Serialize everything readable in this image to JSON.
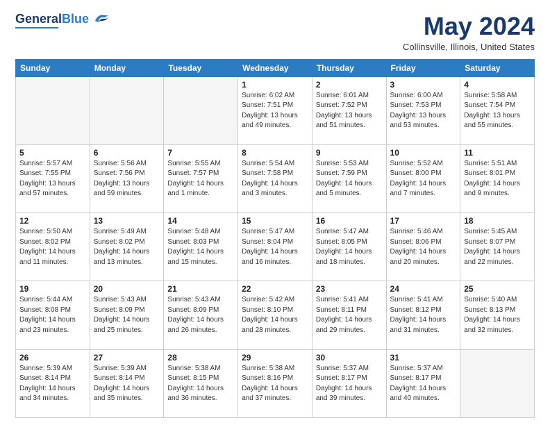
{
  "header": {
    "logo_general": "General",
    "logo_blue": "Blue",
    "month": "May 2024",
    "location": "Collinsville, Illinois, United States"
  },
  "weekdays": [
    "Sunday",
    "Monday",
    "Tuesday",
    "Wednesday",
    "Thursday",
    "Friday",
    "Saturday"
  ],
  "weeks": [
    [
      {
        "day": "",
        "info": ""
      },
      {
        "day": "",
        "info": ""
      },
      {
        "day": "",
        "info": ""
      },
      {
        "day": "1",
        "info": "Sunrise: 6:02 AM\nSunset: 7:51 PM\nDaylight: 13 hours\nand 49 minutes."
      },
      {
        "day": "2",
        "info": "Sunrise: 6:01 AM\nSunset: 7:52 PM\nDaylight: 13 hours\nand 51 minutes."
      },
      {
        "day": "3",
        "info": "Sunrise: 6:00 AM\nSunset: 7:53 PM\nDaylight: 13 hours\nand 53 minutes."
      },
      {
        "day": "4",
        "info": "Sunrise: 5:58 AM\nSunset: 7:54 PM\nDaylight: 13 hours\nand 55 minutes."
      }
    ],
    [
      {
        "day": "5",
        "info": "Sunrise: 5:57 AM\nSunset: 7:55 PM\nDaylight: 13 hours\nand 57 minutes."
      },
      {
        "day": "6",
        "info": "Sunrise: 5:56 AM\nSunset: 7:56 PM\nDaylight: 13 hours\nand 59 minutes."
      },
      {
        "day": "7",
        "info": "Sunrise: 5:55 AM\nSunset: 7:57 PM\nDaylight: 14 hours\nand 1 minute."
      },
      {
        "day": "8",
        "info": "Sunrise: 5:54 AM\nSunset: 7:58 PM\nDaylight: 14 hours\nand 3 minutes."
      },
      {
        "day": "9",
        "info": "Sunrise: 5:53 AM\nSunset: 7:59 PM\nDaylight: 14 hours\nand 5 minutes."
      },
      {
        "day": "10",
        "info": "Sunrise: 5:52 AM\nSunset: 8:00 PM\nDaylight: 14 hours\nand 7 minutes."
      },
      {
        "day": "11",
        "info": "Sunrise: 5:51 AM\nSunset: 8:01 PM\nDaylight: 14 hours\nand 9 minutes."
      }
    ],
    [
      {
        "day": "12",
        "info": "Sunrise: 5:50 AM\nSunset: 8:02 PM\nDaylight: 14 hours\nand 11 minutes."
      },
      {
        "day": "13",
        "info": "Sunrise: 5:49 AM\nSunset: 8:02 PM\nDaylight: 14 hours\nand 13 minutes."
      },
      {
        "day": "14",
        "info": "Sunrise: 5:48 AM\nSunset: 8:03 PM\nDaylight: 14 hours\nand 15 minutes."
      },
      {
        "day": "15",
        "info": "Sunrise: 5:47 AM\nSunset: 8:04 PM\nDaylight: 14 hours\nand 16 minutes."
      },
      {
        "day": "16",
        "info": "Sunrise: 5:47 AM\nSunset: 8:05 PM\nDaylight: 14 hours\nand 18 minutes."
      },
      {
        "day": "17",
        "info": "Sunrise: 5:46 AM\nSunset: 8:06 PM\nDaylight: 14 hours\nand 20 minutes."
      },
      {
        "day": "18",
        "info": "Sunrise: 5:45 AM\nSunset: 8:07 PM\nDaylight: 14 hours\nand 22 minutes."
      }
    ],
    [
      {
        "day": "19",
        "info": "Sunrise: 5:44 AM\nSunset: 8:08 PM\nDaylight: 14 hours\nand 23 minutes."
      },
      {
        "day": "20",
        "info": "Sunrise: 5:43 AM\nSunset: 8:09 PM\nDaylight: 14 hours\nand 25 minutes."
      },
      {
        "day": "21",
        "info": "Sunrise: 5:43 AM\nSunset: 8:09 PM\nDaylight: 14 hours\nand 26 minutes."
      },
      {
        "day": "22",
        "info": "Sunrise: 5:42 AM\nSunset: 8:10 PM\nDaylight: 14 hours\nand 28 minutes."
      },
      {
        "day": "23",
        "info": "Sunrise: 5:41 AM\nSunset: 8:11 PM\nDaylight: 14 hours\nand 29 minutes."
      },
      {
        "day": "24",
        "info": "Sunrise: 5:41 AM\nSunset: 8:12 PM\nDaylight: 14 hours\nand 31 minutes."
      },
      {
        "day": "25",
        "info": "Sunrise: 5:40 AM\nSunset: 8:13 PM\nDaylight: 14 hours\nand 32 minutes."
      }
    ],
    [
      {
        "day": "26",
        "info": "Sunrise: 5:39 AM\nSunset: 8:14 PM\nDaylight: 14 hours\nand 34 minutes."
      },
      {
        "day": "27",
        "info": "Sunrise: 5:39 AM\nSunset: 8:14 PM\nDaylight: 14 hours\nand 35 minutes."
      },
      {
        "day": "28",
        "info": "Sunrise: 5:38 AM\nSunset: 8:15 PM\nDaylight: 14 hours\nand 36 minutes."
      },
      {
        "day": "29",
        "info": "Sunrise: 5:38 AM\nSunset: 8:16 PM\nDaylight: 14 hours\nand 37 minutes."
      },
      {
        "day": "30",
        "info": "Sunrise: 5:37 AM\nSunset: 8:17 PM\nDaylight: 14 hours\nand 39 minutes."
      },
      {
        "day": "31",
        "info": "Sunrise: 5:37 AM\nSunset: 8:17 PM\nDaylight: 14 hours\nand 40 minutes."
      },
      {
        "day": "",
        "info": ""
      }
    ]
  ]
}
